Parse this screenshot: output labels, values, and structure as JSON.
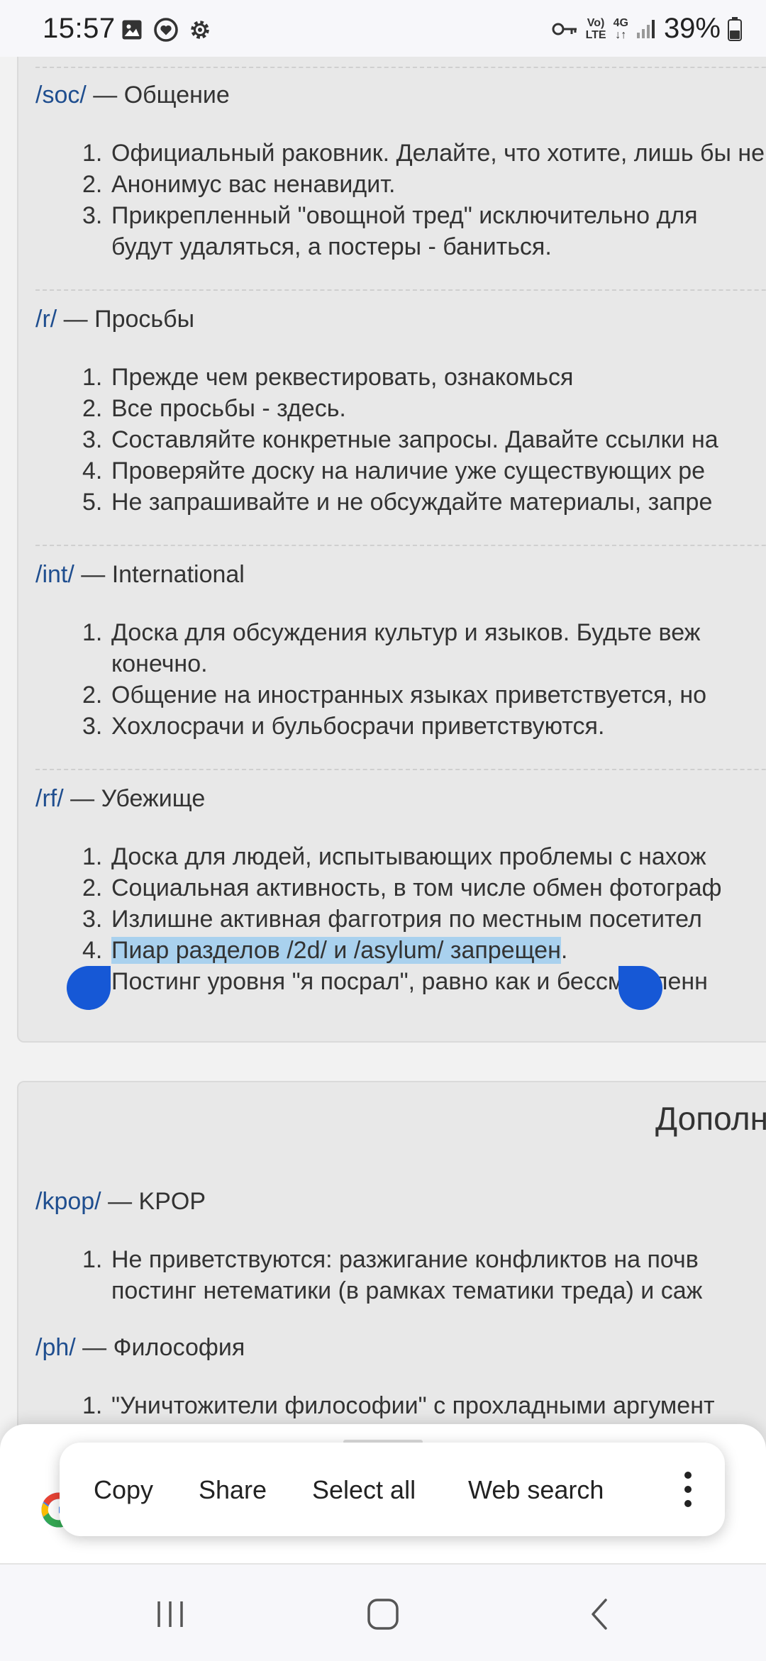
{
  "status_bar": {
    "time": "15:57",
    "network_small": "Vo)\nLTE",
    "network_type": "4G",
    "battery": "39%"
  },
  "sections": [
    {
      "board": "/soc/",
      "separator": " — ",
      "name": "Общение",
      "rules": [
        {
          "num": "1.",
          "lines": [
            "Официальный раковник. Делайте, что хотите, лишь бы не нарушали правила."
          ]
        },
        {
          "num": "2.",
          "lines": [
            "Анонимус вас ненавидит."
          ]
        },
        {
          "num": "3.",
          "lines": [
            "Прикрепленный \"овощной тред\" исключительно для",
            "будут удаляться, а постеры - баниться."
          ]
        }
      ]
    },
    {
      "board": "/r/",
      "separator": " — ",
      "name": "Просьбы",
      "rules": [
        {
          "num": "1.",
          "lines": [
            "Прежде чем реквестировать, ознакомься"
          ]
        },
        {
          "num": "2.",
          "lines": [
            "Все просьбы - здесь."
          ]
        },
        {
          "num": "3.",
          "lines": [
            "Составляйте конкретные запросы. Давайте ссылки на"
          ]
        },
        {
          "num": "4.",
          "lines": [
            "Проверяйте доску на наличие уже существующих ре"
          ]
        },
        {
          "num": "5.",
          "lines": [
            "Не запрашивайте и не обсуждайте материалы, запре"
          ]
        }
      ]
    },
    {
      "board": "/int/",
      "separator": " — ",
      "name": "International",
      "rules": [
        {
          "num": "1.",
          "lines": [
            "Доска для обсуждения культур и языков. Будьте веж",
            "конечно."
          ]
        },
        {
          "num": "2.",
          "lines": [
            "Общение на иностранных языках приветствуется, но"
          ]
        },
        {
          "num": "3.",
          "lines": [
            "Хохлосрачи и бульбосрачи приветствуются."
          ]
        }
      ]
    },
    {
      "board": "/rf/",
      "separator": " — ",
      "name": "Убежище",
      "rules": [
        {
          "num": "1.",
          "lines": [
            "Доска для людей, испытывающих проблемы с нахож"
          ]
        },
        {
          "num": "2.",
          "lines": [
            "Социальная активность, в том числе обмен фотограф"
          ]
        },
        {
          "num": "3.",
          "lines": [
            "Излишне активная фагготрия по местным посетител"
          ]
        },
        {
          "num": "4.",
          "selected": "Пиар разделов /2d/ и /asylum/ запрещен",
          "after": ".",
          "lines": [
            "Постинг уровня \"я посрал\", равно как и бессмысленн"
          ]
        }
      ]
    },
    {
      "board": "/kpop/",
      "separator": " — ",
      "name": "KPOP",
      "rules": [
        {
          "num": "1.",
          "lines": [
            "Не приветствуются: разжигание конфликтов на почв",
            "постинг нетематики (в рамках тематики треда) и саж"
          ]
        }
      ]
    },
    {
      "board": "/ph/",
      "separator": " — ",
      "name": "Философия",
      "rules": [
        {
          "num": "1.",
          "lines": [
            "\"Уничтожители философии\" с прохладными аргумент"
          ]
        }
      ]
    }
  ],
  "panel_heading": "Дополн",
  "selection_toolbar": {
    "copy": "Copy",
    "share": "Share",
    "select_all": "Select all",
    "web_search": "Web search"
  },
  "colors": {
    "link": "#1f4e8f",
    "selection": "#a9d1ee",
    "handle": "#1658d6"
  }
}
